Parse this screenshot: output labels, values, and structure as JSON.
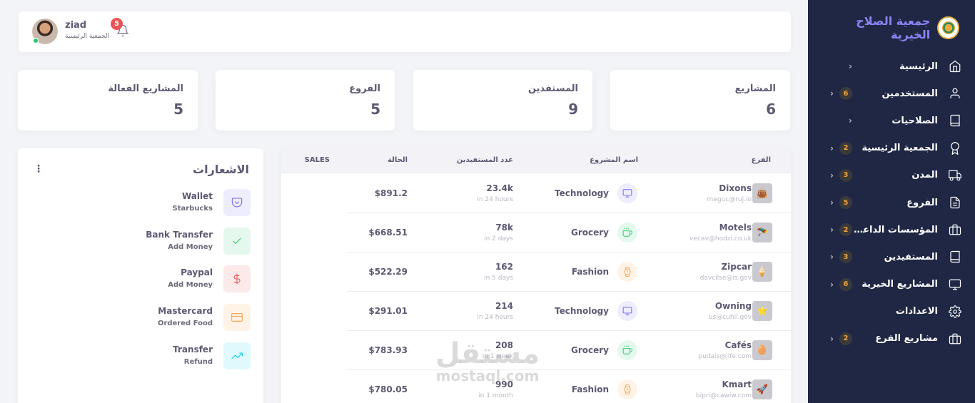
{
  "sidebar": {
    "brand_title": "جمعية الصلاح الخيرية",
    "items": [
      {
        "label": "الرئيسية",
        "badge": "",
        "icon": "home-icon"
      },
      {
        "label": "المستخدمين",
        "badge": "6",
        "icon": "user-icon"
      },
      {
        "label": "الصلاحيات",
        "badge": "",
        "icon": "book-icon"
      },
      {
        "label": "الجمعية الرئيسية",
        "badge": "2",
        "icon": "award-icon"
      },
      {
        "label": "المدن",
        "badge": "3",
        "icon": "truck-icon"
      },
      {
        "label": "الفروع",
        "badge": "5",
        "icon": "file-icon"
      },
      {
        "label": "المؤسسات الداعمة",
        "badge": "2",
        "icon": "briefcase-icon"
      },
      {
        "label": "المستفيدين",
        "badge": "3",
        "icon": "book-icon"
      },
      {
        "label": "المشاريع الخيرية",
        "badge": "6",
        "icon": "monitor-icon"
      },
      {
        "label": "الاعدادات",
        "badge": "",
        "icon": "settings-icon"
      },
      {
        "label": "مشاريع الفرع",
        "badge": "2",
        "icon": "briefcase-icon"
      }
    ]
  },
  "topbar": {
    "user_name": "ziad",
    "user_role": "الجمعية الرئيسية",
    "notification_count": "5"
  },
  "stats": [
    {
      "title": "المشاريع",
      "value": "6"
    },
    {
      "title": "المستفدين",
      "value": "9"
    },
    {
      "title": "الفروع",
      "value": "5"
    },
    {
      "title": "المشاريع الفعالة",
      "value": "5"
    }
  ],
  "notifications": {
    "title": "الاشعارات",
    "kebab": "⋮",
    "items": [
      {
        "title": "Wallet",
        "subtitle": "Starbucks",
        "icon": "pocket-icon",
        "color": "#7367f0",
        "bg": "#eeedfd"
      },
      {
        "title": "Bank Transfer",
        "subtitle": "Add Money",
        "icon": "check-icon",
        "color": "#28c76f",
        "bg": "#e5f8ed"
      },
      {
        "title": "Paypal",
        "subtitle": "Add Money",
        "icon": "dollar-icon",
        "color": "#ea5455",
        "bg": "#fce9e9"
      },
      {
        "title": "Mastercard",
        "subtitle": "Ordered Food",
        "icon": "credit-card-icon",
        "color": "#ff9f43",
        "bg": "#fff3e8"
      },
      {
        "title": "Transfer",
        "subtitle": "Refund",
        "icon": "trending-up-icon",
        "color": "#00cfe8",
        "bg": "#e0f9fc"
      }
    ]
  },
  "table": {
    "headers": {
      "branch": "الفرع",
      "project": "اسم المشروع",
      "beneficiaries": "عدد المستفيدين",
      "status": "الحالة",
      "sales": "SALES"
    },
    "rows": [
      {
        "branch": "Dixons",
        "email": "meguc@ruj.io",
        "thumb": "👜",
        "project": "Technology",
        "project_icon": "monitor-icon",
        "icon_color": "#7367f0",
        "icon_bg": "#eeedfd",
        "beneficiaries": "23.4k",
        "time": "in 24 hours",
        "status": "$891.2"
      },
      {
        "branch": "Motels",
        "email": "vecav@hodzi.co.uk",
        "thumb": "🪂",
        "project": "Grocery",
        "project_icon": "coffee-icon",
        "icon_color": "#28c76f",
        "icon_bg": "#e5f8ed",
        "beneficiaries": "78k",
        "time": "in 2 days",
        "status": "$668.51"
      },
      {
        "branch": "Zipcar",
        "email": "davcilse@is.gov",
        "thumb": "🍦",
        "project": "Fashion",
        "project_icon": "watch-icon",
        "icon_color": "#ff9f43",
        "icon_bg": "#fff3e8",
        "beneficiaries": "162",
        "time": "in 5 days",
        "status": "$522.29"
      },
      {
        "branch": "Owning",
        "email": "us@cuhil.gov",
        "thumb": "⭐",
        "project": "Technology",
        "project_icon": "monitor-icon",
        "icon_color": "#7367f0",
        "icon_bg": "#eeedfd",
        "beneficiaries": "214",
        "time": "in 24 hours",
        "status": "$291.01"
      },
      {
        "branch": "Cafés",
        "email": "pudais@jife.com",
        "thumb": "🥚",
        "project": "Grocery",
        "project_icon": "coffee-icon",
        "icon_color": "#28c76f",
        "icon_bg": "#e5f8ed",
        "beneficiaries": "208",
        "time": "in 1 week",
        "status": "$783.93"
      },
      {
        "branch": "Kmart",
        "email": "bipri@cawiw.com",
        "thumb": "🚀",
        "project": "Fashion",
        "project_icon": "watch-icon",
        "icon_color": "#ff9f43",
        "icon_bg": "#fff3e8",
        "beneficiaries": "990",
        "time": "in 1 month",
        "status": "$780.05"
      }
    ]
  },
  "watermark": {
    "line1": "مستقل",
    "line2": "mostaql.com"
  }
}
